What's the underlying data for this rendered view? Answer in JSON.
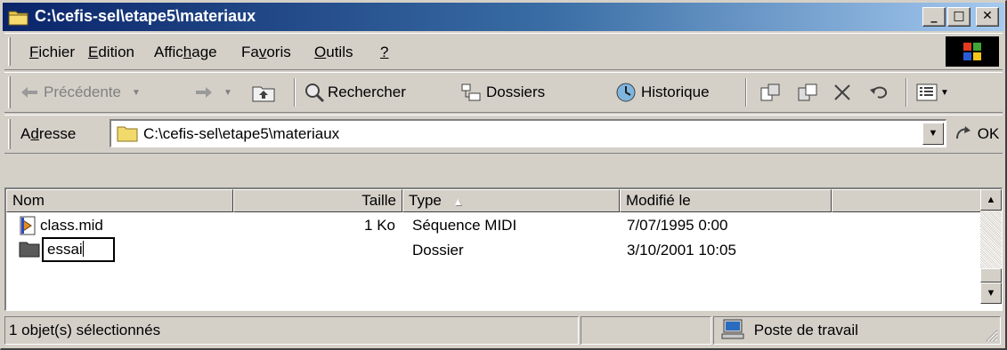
{
  "window": {
    "title": "C:\\cefis-sel\\etape5\\materiaux",
    "controls": [
      "_",
      "□",
      "✕"
    ]
  },
  "menu": {
    "items": [
      {
        "pre": "",
        "key": "F",
        "post": "ichier"
      },
      {
        "pre": "",
        "key": "E",
        "post": "dition"
      },
      {
        "pre": "Affic",
        "key": "h",
        "post": "age"
      },
      {
        "pre": "Fa",
        "key": "v",
        "post": "oris"
      },
      {
        "pre": "",
        "key": "O",
        "post": "utils"
      },
      {
        "pre": "",
        "key": "?",
        "post": ""
      }
    ]
  },
  "toolbar": {
    "back": "Précédente",
    "search": "Rechercher",
    "folders": "Dossiers",
    "history": "Historique"
  },
  "address": {
    "label_pre": "A",
    "label_key": "d",
    "label_post": "resse",
    "value": "C:\\cefis-sel\\etape5\\materiaux",
    "go": "OK"
  },
  "list": {
    "columns": {
      "name": "Nom",
      "size": "Taille",
      "type": "Type",
      "sort_indicator": "▲",
      "modified": "Modifié le"
    },
    "rows": [
      {
        "name": "class.mid",
        "size": "1 Ko",
        "type": "Séquence MIDI",
        "modified": "7/07/1995 0:00",
        "icon": "midi-file-icon"
      },
      {
        "name": "essai",
        "size": "",
        "type": "Dossier",
        "modified": "3/10/2001 10:05",
        "icon": "folder-icon"
      }
    ]
  },
  "status": {
    "selection": "1 objet(s) sélectionnés",
    "zone": "Poste de travail"
  },
  "colors": {
    "title_start": "#0a246a",
    "title_end": "#a6caf0",
    "face": "#d4d0c8"
  }
}
